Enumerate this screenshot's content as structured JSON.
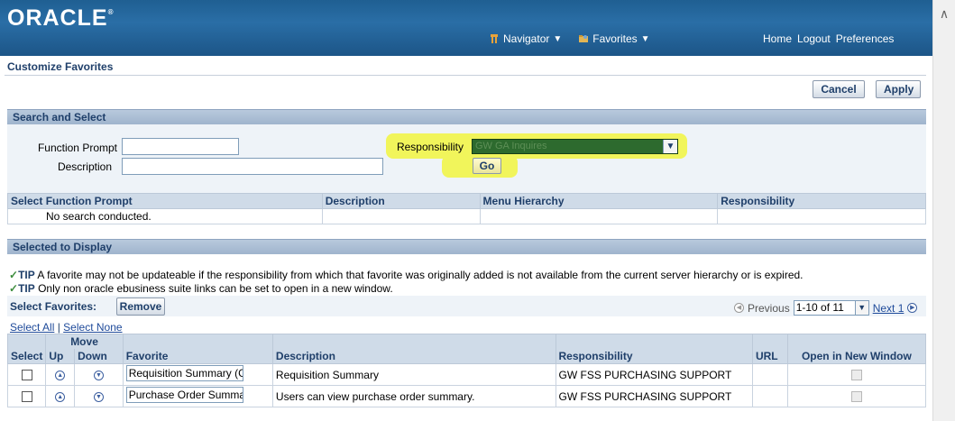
{
  "header": {
    "logo": "ORACLE",
    "logo_mark": "®",
    "navigator_label": "Navigator",
    "favorites_label": "Favorites",
    "home_label": "Home",
    "logout_label": "Logout",
    "preferences_label": "Preferences"
  },
  "page": {
    "title": "Customize Favorites",
    "cancel_label": "Cancel",
    "apply_label": "Apply"
  },
  "search": {
    "section_title": "Search and Select",
    "function_prompt_label": "Function Prompt",
    "function_prompt_value": "",
    "description_label": "Description",
    "description_value": "",
    "responsibility_label": "Responsibility",
    "responsibility_value": "GW GA Inquires",
    "go_label": "Go",
    "highlight_color": "#f1f55b",
    "results_headers": {
      "select_function_prompt": "Select Function Prompt",
      "description": "Description",
      "menu_hierarchy": "Menu Hierarchy",
      "responsibility": "Responsibility"
    },
    "no_results_text": "No search conducted."
  },
  "selected": {
    "section_title": "Selected to Display",
    "tip_label": "TIP",
    "tip1": "A favorite may not be updateable if the responsibility from which that favorite was originally added is not available from the current server hierarchy or is expired.",
    "tip2": "Only non oracle ebusiness suite links can be set to open in a new window.",
    "select_favorites_label": "Select Favorites:",
    "remove_label": "Remove",
    "previous_label": "Previous",
    "range_value": "1-10 of 11",
    "next_label": "Next 1",
    "select_all_label": "Select All",
    "separator": "|",
    "select_none_label": "Select None",
    "headers": {
      "select": "Select",
      "move": "Move",
      "up": "Up",
      "down": "Down",
      "favorite": "Favorite",
      "description": "Description",
      "responsibility": "Responsibility",
      "url": "URL",
      "open_new_window": "Open in New Window"
    },
    "rows": [
      {
        "favorite": "Requisition Summary (G",
        "description": "Requisition Summary",
        "responsibility": "GW FSS PURCHASING SUPPORT",
        "url": ""
      },
      {
        "favorite": "Purchase Order Summar",
        "description": "Users can view purchase order summary.",
        "responsibility": "GW FSS PURCHASING SUPPORT",
        "url": ""
      }
    ]
  }
}
